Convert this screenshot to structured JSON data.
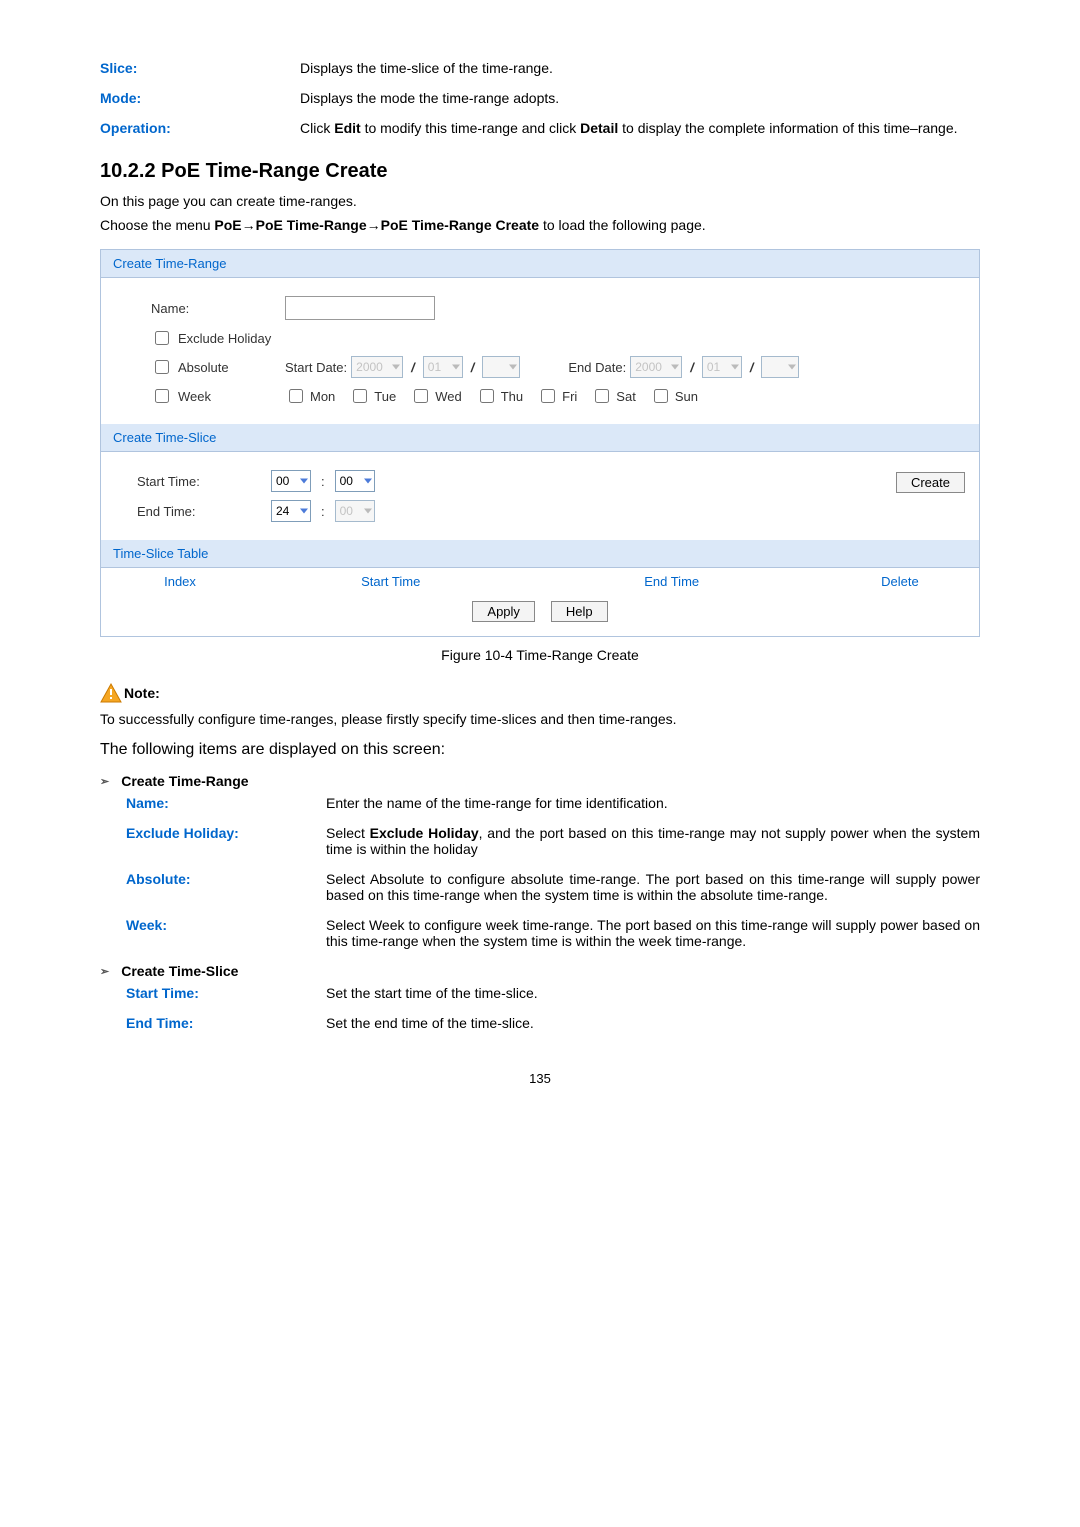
{
  "top_defs": [
    {
      "label": "Slice:",
      "value": "Displays the time-slice of the time-range."
    },
    {
      "label": "Mode:",
      "value": "Displays the mode the time-range adopts."
    },
    {
      "label": "Operation:",
      "value_parts": [
        "Click ",
        "Edit",
        " to modify this time-range and click ",
        "Detail",
        " to display the complete information of this time–range."
      ]
    }
  ],
  "heading": "10.2.2 PoE Time-Range Create",
  "intro1": "On this page you can create time-ranges.",
  "intro2_parts": [
    "Choose the menu ",
    "PoE→PoE Time-Range→PoE Time-Range Create",
    " to load the following page."
  ],
  "panel1": {
    "title": "Create Time-Range",
    "name_label": "Name:",
    "exclude_label": "Exclude Holiday",
    "absolute_label": "Absolute",
    "start_date_label": "Start Date:",
    "end_date_label": "End Date:",
    "week_label": "Week",
    "days": [
      "Mon",
      "Tue",
      "Wed",
      "Thu",
      "Fri",
      "Sat",
      "Sun"
    ],
    "year": "2000",
    "month": "01",
    "day_blank": ""
  },
  "panel2": {
    "title": "Create Time-Slice",
    "start_label": "Start Time:",
    "end_label": "End Time:",
    "start_h": "00",
    "start_m": "00",
    "end_h": "24",
    "end_m": "00",
    "create_btn": "Create"
  },
  "panel3": {
    "title": "Time-Slice Table",
    "hdr_index": "Index",
    "hdr_start": "Start Time",
    "hdr_end": "End Time",
    "hdr_delete": "Delete",
    "apply": "Apply",
    "help": "Help"
  },
  "figure_caption": "Figure 10-4 Time-Range Create",
  "note_label": "Note:",
  "note_text": "To successfully configure time-ranges, please firstly specify time-slices and then time-ranges.",
  "displayed_text": "The following items are displayed on this screen:",
  "section1_title": "Create Time-Range",
  "section1_defs": [
    {
      "label": "Name:",
      "value": "Enter the name of the time-range for time identification."
    },
    {
      "label": "Exclude Holiday:",
      "value_parts": [
        "Select ",
        "Exclude Holiday",
        ", and the port based on this time-range may not supply power when the system time is within the holiday"
      ]
    },
    {
      "label": "Absolute:",
      "value": "Select Absolute to configure absolute time-range. The port based on this time-range will supply power based on this time-range when the system time is within the absolute time-range."
    },
    {
      "label": "Week:",
      "value": "Select Week to configure week time-range. The port based on this time-range will supply power based on this time-range when the system time is within the week time-range."
    }
  ],
  "section2_title": "Create Time-Slice",
  "section2_defs": [
    {
      "label": "Start Time:",
      "value": "Set the start time of the time-slice."
    },
    {
      "label": "End Time:",
      "value": "Set the end time of the time-slice."
    }
  ],
  "page_num": "135"
}
